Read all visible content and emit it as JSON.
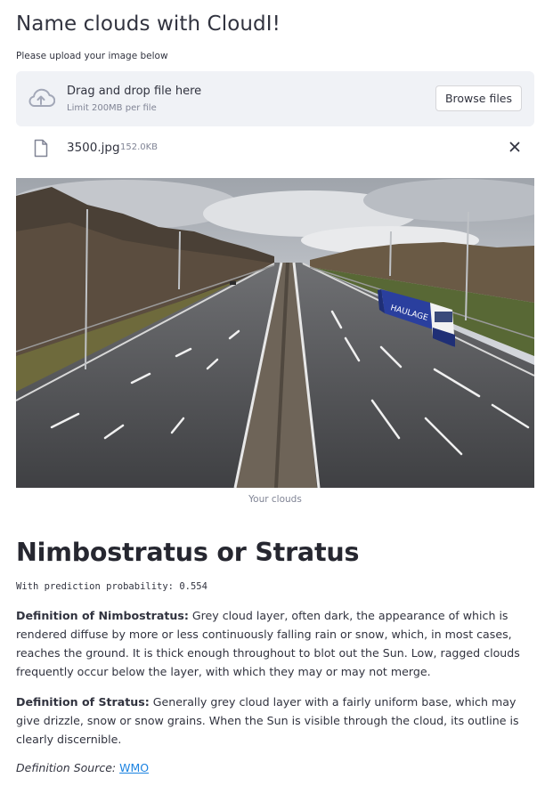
{
  "app": {
    "title": "Name clouds with CloudI!",
    "upload_label": "Please upload your image below"
  },
  "uploader": {
    "drag_text": "Drag and drop file here",
    "limit_text": "Limit 200MB per file",
    "browse_label": "Browse files",
    "icon": "cloud-upload-icon"
  },
  "file": {
    "name": "3500.jpg",
    "size": "152.0KB",
    "icon": "file-icon",
    "remove_icon": "close-icon"
  },
  "image": {
    "caption": "Your clouds"
  },
  "result": {
    "title": "Nimbostratus or Stratus",
    "prediction": "With prediction probability: 0.554",
    "def1_label": "Definition of Nimbostratus:",
    "def1_text": " Grey cloud layer, often dark, the appearance of which is rendered diffuse by more or less continuously falling rain or snow, which, in most cases, reaches the ground. It is thick enough throughout to blot out the Sun. Low, ragged clouds frequently occur below the layer, with which they may or may not merge.",
    "def2_label": "Definition of Stratus:",
    "def2_text": " Generally grey cloud layer with a fairly uniform base, which may give drizzle, snow or snow grains. When the Sun is visible through the cloud, its outline is clearly discernible.",
    "source_label": "Definition Source: ",
    "source_link": "WMO"
  },
  "colors": {
    "accent_link": "#1c83e1",
    "dropzone_bg": "#f0f2f6",
    "text": "#31333f",
    "muted": "#808495"
  }
}
